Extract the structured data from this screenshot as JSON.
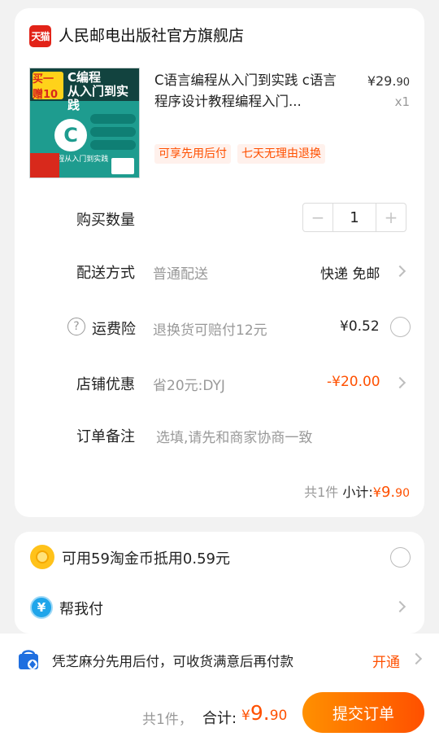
{
  "shop": {
    "badge": "天猫",
    "name": "人民邮电出版社官方旗舰店"
  },
  "product": {
    "cover": {
      "gift": "买一赠10",
      "title": "C编程\n从入门到实践",
      "logo": "C",
      "subtitle": "C编程从入门到实践"
    },
    "title": "C语言编程从入门到实践 c语言程序设计教程编程入门...",
    "price_symbol": "¥",
    "price_int": "29.",
    "price_dec": "90",
    "quantity": "x1",
    "tags": [
      "可享先用后付",
      "七天无理由退换"
    ]
  },
  "purchase_qty": {
    "label": "购买数量",
    "minus": "−",
    "value": "1",
    "plus": "+"
  },
  "delivery": {
    "label": "配送方式",
    "type": "普通配送",
    "value": "快递 免邮"
  },
  "insurance": {
    "help_icon": "?",
    "label": "运费险",
    "desc": "退换货可赔付12元",
    "price": "¥0.52"
  },
  "shop_discount": {
    "label": "店铺优惠",
    "desc": "省20元:DYJ",
    "value": "-¥20.00"
  },
  "note": {
    "label": "订单备注",
    "placeholder": "选填,请先和商家协商一致"
  },
  "subtotal": {
    "count": "共1件",
    "label": "小计:",
    "symbol": "¥",
    "int": "9.",
    "dec": "90"
  },
  "coins": {
    "label": "可用59淘金币抵用0.59元"
  },
  "help_pay": {
    "icon": "¥",
    "label": "帮我付"
  },
  "credit": {
    "text": "凭芝麻分先用后付，可收货满意后再付款",
    "action": "开通"
  },
  "bottom": {
    "count": "共1件，",
    "label": "合计:",
    "symbol": "¥",
    "int": "9.",
    "dec": "90",
    "submit": "提交订单"
  },
  "colors": {
    "accent": "#ff5000",
    "tmall_red": "#e22318",
    "coin": "#ffc21a",
    "pay_blue": "#1fa5ea"
  }
}
